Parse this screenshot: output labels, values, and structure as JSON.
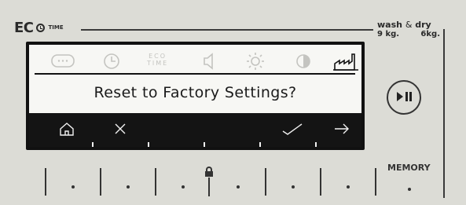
{
  "brand": {
    "eco": "EC",
    "time": "TIME"
  },
  "capacity": {
    "title_wash": "wash",
    "amp": "&",
    "title_dry": "dry",
    "wash_kg": "9 kg.",
    "dry_kg": "6kg."
  },
  "display": {
    "eco_time_icon_line1": "ECO",
    "eco_time_icon_line2": "TIME",
    "prompt": "Reset to Factory Settings?",
    "nav": [
      "home-icon",
      "cancel-icon",
      "confirm-icon",
      "next-icon"
    ]
  },
  "controls": {
    "play_pause_icon": "play-pause-icon",
    "memory_label": "MEMORY"
  },
  "colors": {
    "display_bg": "#f7f7f4",
    "nav_bar": "#141414",
    "panel_bg": "#dcdcd6"
  }
}
